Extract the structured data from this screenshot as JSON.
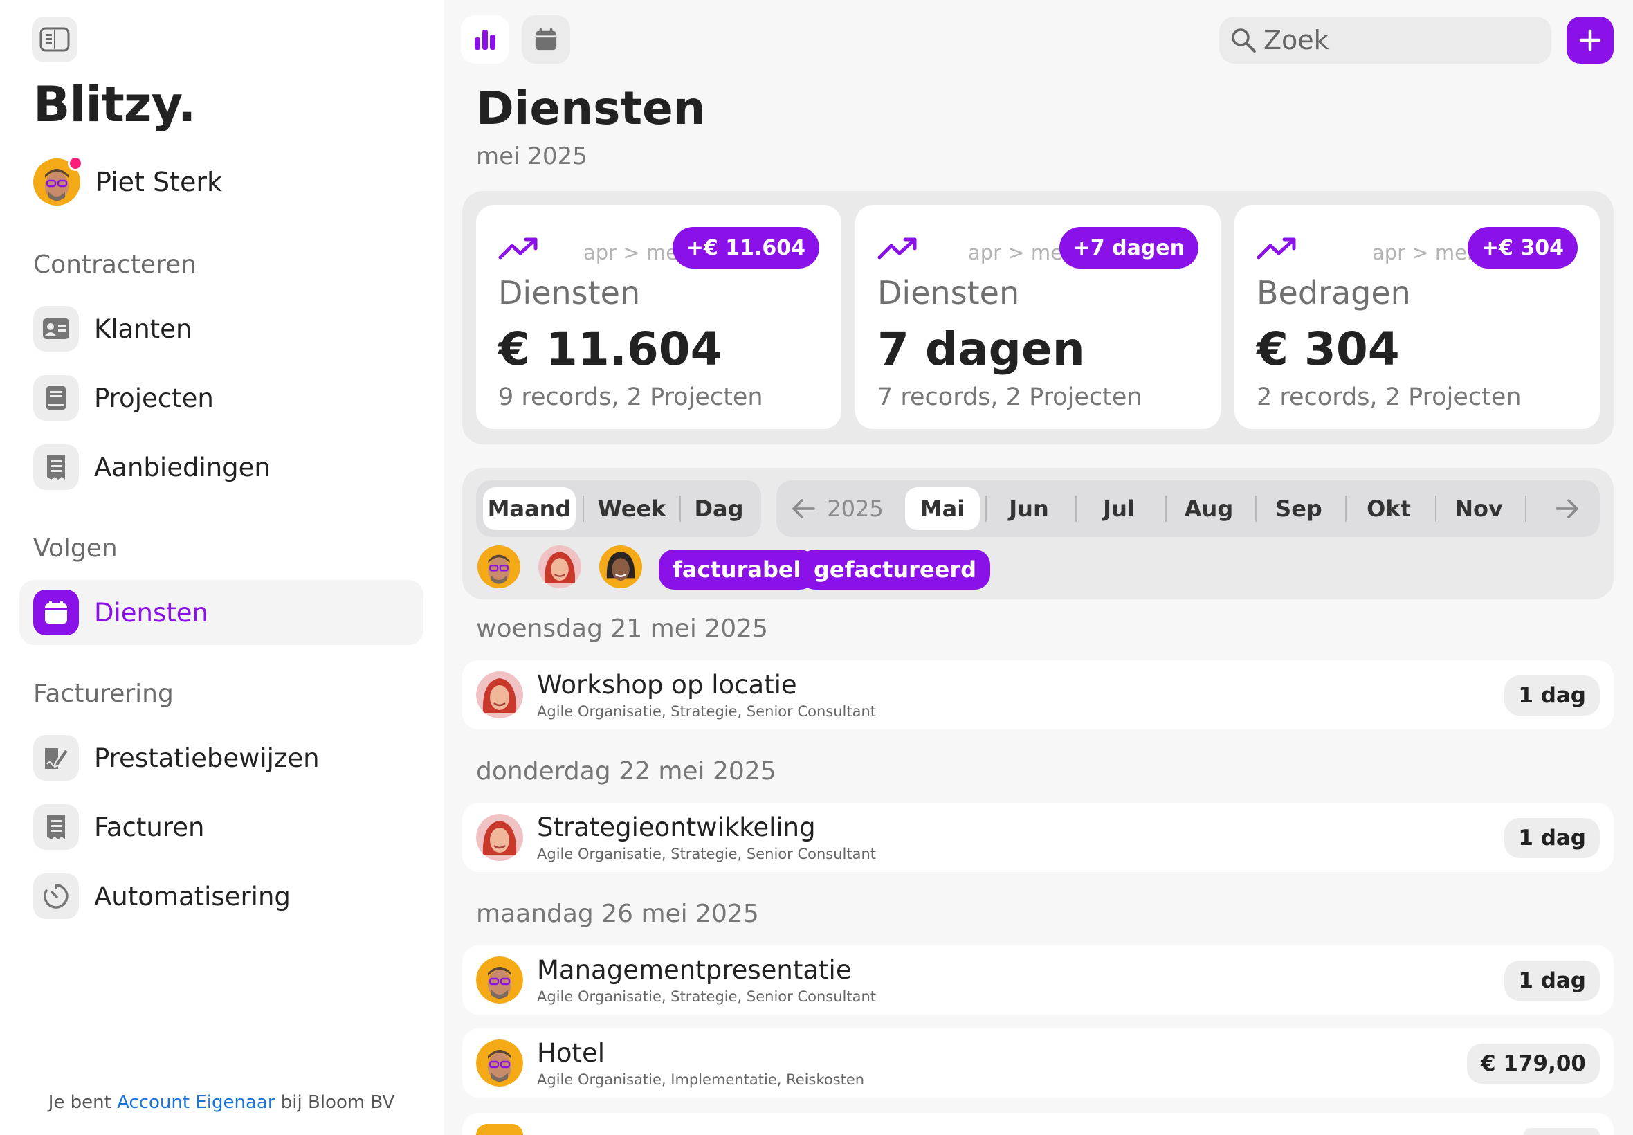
{
  "app": {
    "brand": "Blitzy."
  },
  "user": {
    "name": "Piet Sterk"
  },
  "sidebar": {
    "sections": [
      {
        "title": "Contracteren",
        "items": [
          {
            "label": "Klanten",
            "icon": "contact-card-icon"
          },
          {
            "label": "Projecten",
            "icon": "book-icon"
          },
          {
            "label": "Aanbiedingen",
            "icon": "receipt-icon"
          }
        ]
      },
      {
        "title": "Volgen",
        "items": [
          {
            "label": "Diensten",
            "icon": "calendar-icon",
            "active": true
          }
        ]
      },
      {
        "title": "Facturering",
        "items": [
          {
            "label": "Prestatiebewijzen",
            "icon": "signed-document-icon"
          },
          {
            "label": "Facturen",
            "icon": "receipt-icon"
          },
          {
            "label": "Automatisering",
            "icon": "timer-icon"
          }
        ]
      }
    ],
    "footer": {
      "prefix": "Je bent",
      "role": "Account Eigenaar",
      "middle": "bij",
      "company": "Bloom BV"
    }
  },
  "toolbar": {
    "search_placeholder": "Zoek"
  },
  "page": {
    "title": "Diensten",
    "subtitle": "mei 2025"
  },
  "stats": [
    {
      "compare": "apr > mei",
      "badge": "+€ 11.604",
      "label": "Diensten",
      "value": "€ 11.604",
      "sub": "9 records, 2 Projecten"
    },
    {
      "compare": "apr > mei",
      "badge": "+7 dagen",
      "label": "Diensten",
      "value": "7 dagen",
      "sub": "7 records, 2 Projecten"
    },
    {
      "compare": "apr > mei",
      "badge": "+€ 304",
      "label": "Bedragen",
      "value": "€ 304",
      "sub": "2 records, 2 Projecten"
    }
  ],
  "filters": {
    "views": [
      "Maand",
      "Week",
      "Dag"
    ],
    "selected_view": "Maand",
    "year": "2025",
    "months": [
      "Mai",
      "Jun",
      "Jul",
      "Aug",
      "Sep",
      "Okt",
      "Nov"
    ],
    "selected_month": "Mai",
    "chips": [
      "facturabel",
      "gefactureerd"
    ]
  },
  "days": [
    {
      "heading": "woensdag 21 mei 2025",
      "entries": [
        {
          "title": "Workshop op locatie",
          "details": "Agile Organisatie, Strategie, Senior Consultant",
          "amount": "1 dag"
        }
      ]
    },
    {
      "heading": "donderdag 22 mei 2025",
      "entries": [
        {
          "title": "Strategieontwikkeling",
          "details": "Agile Organisatie, Strategie, Senior Consultant",
          "amount": "1 dag"
        }
      ]
    },
    {
      "heading": "maandag 26 mei 2025",
      "entries": [
        {
          "title": "Managementpresentatie",
          "details": "Agile Organisatie, Strategie, Senior Consultant",
          "amount": "1 dag"
        },
        {
          "title": "Hotel",
          "details": "Agile Organisatie, Implementatie, Reiskosten",
          "amount": "€ 179,00"
        }
      ]
    }
  ],
  "colors": {
    "accent": "#8a12e8",
    "background": "#f7f7f8",
    "link": "#1a73d9"
  }
}
